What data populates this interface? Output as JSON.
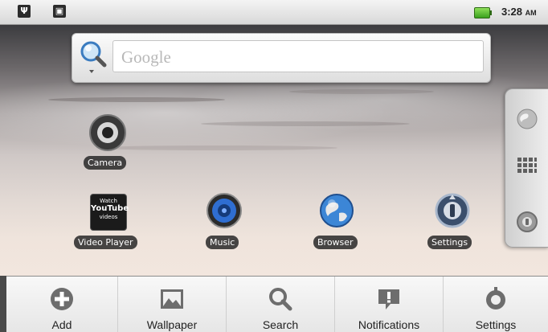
{
  "status_bar": {
    "time": "3:28",
    "ampm": "AM",
    "notification_icons": [
      "usb-icon",
      "android-debug-icon"
    ],
    "battery_color": "#3aa11e"
  },
  "search_widget": {
    "placeholder": "Google",
    "icon": "magnifier-icon"
  },
  "home_apps": [
    {
      "label": "Camera",
      "icon": "camera-icon"
    },
    {
      "label": "Video Player",
      "icon": "youtube-icon",
      "icon_text": [
        "Watch",
        "YouTube",
        "videos"
      ]
    },
    {
      "label": "Music",
      "icon": "music-icon"
    },
    {
      "label": "Browser",
      "icon": "globe-icon"
    },
    {
      "label": "Settings",
      "icon": "settings-icon"
    }
  ],
  "side_handle": {
    "items": [
      "globe-icon",
      "app-grid-icon",
      "phone-icon"
    ]
  },
  "options_menu": {
    "items": [
      {
        "label": "Add",
        "icon": "add-icon"
      },
      {
        "label": "Wallpaper",
        "icon": "wallpaper-icon"
      },
      {
        "label": "Search",
        "icon": "search-icon"
      },
      {
        "label": "Notifications",
        "icon": "notifications-icon"
      },
      {
        "label": "Settings",
        "icon": "settings-icon"
      }
    ]
  }
}
